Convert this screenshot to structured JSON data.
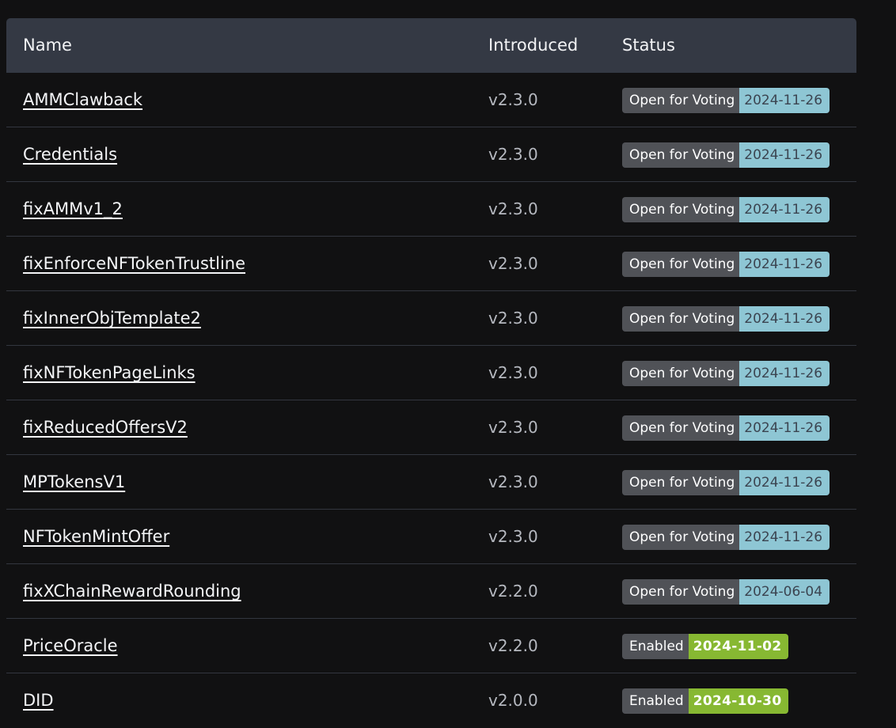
{
  "table": {
    "headers": {
      "name": "Name",
      "introduced": "Introduced",
      "status": "Status"
    },
    "rows": [
      {
        "name": "AMMClawback",
        "introduced": "v2.3.0",
        "status": "Open for Voting",
        "date": "2024-11-26",
        "status_type": "voting"
      },
      {
        "name": "Credentials",
        "introduced": "v2.3.0",
        "status": "Open for Voting",
        "date": "2024-11-26",
        "status_type": "voting"
      },
      {
        "name": "fixAMMv1_2",
        "introduced": "v2.3.0",
        "status": "Open for Voting",
        "date": "2024-11-26",
        "status_type": "voting"
      },
      {
        "name": "fixEnforceNFTokenTrustline",
        "introduced": "v2.3.0",
        "status": "Open for Voting",
        "date": "2024-11-26",
        "status_type": "voting"
      },
      {
        "name": "fixInnerObjTemplate2",
        "introduced": "v2.3.0",
        "status": "Open for Voting",
        "date": "2024-11-26",
        "status_type": "voting"
      },
      {
        "name": "fixNFTokenPageLinks",
        "introduced": "v2.3.0",
        "status": "Open for Voting",
        "date": "2024-11-26",
        "status_type": "voting"
      },
      {
        "name": "fixReducedOffersV2",
        "introduced": "v2.3.0",
        "status": "Open for Voting",
        "date": "2024-11-26",
        "status_type": "voting"
      },
      {
        "name": "MPTokensV1",
        "introduced": "v2.3.0",
        "status": "Open for Voting",
        "date": "2024-11-26",
        "status_type": "voting"
      },
      {
        "name": "NFTokenMintOffer",
        "introduced": "v2.3.0",
        "status": "Open for Voting",
        "date": "2024-11-26",
        "status_type": "voting"
      },
      {
        "name": "fixXChainRewardRounding",
        "introduced": "v2.2.0",
        "status": "Open for Voting",
        "date": "2024-06-04",
        "status_type": "voting"
      },
      {
        "name": "PriceOracle",
        "introduced": "v2.2.0",
        "status": "Enabled",
        "date": "2024-11-02",
        "status_type": "enabled"
      },
      {
        "name": "DID",
        "introduced": "v2.0.0",
        "status": "Enabled",
        "date": "2024-10-30",
        "status_type": "enabled"
      }
    ]
  },
  "colors": {
    "background": "#111112",
    "header_background": "#343944",
    "status_badge": "#505257",
    "voting_date_badge": "#8ec6d4",
    "enabled_date_badge": "#87b832"
  }
}
